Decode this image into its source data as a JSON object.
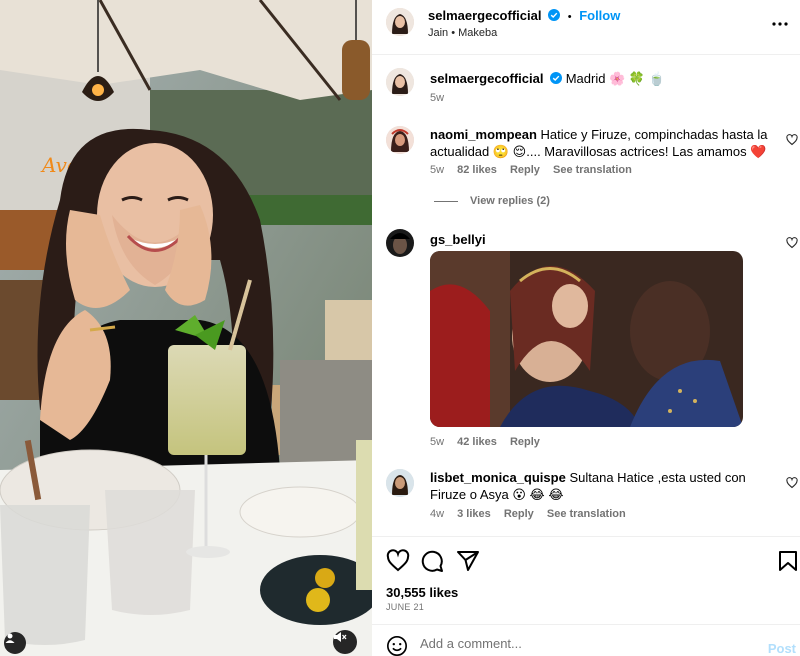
{
  "post": {
    "username": "selmaergecofficial",
    "follow_label": "Follow",
    "separator": "•",
    "audio": "Jain • Makeba",
    "caption": "Madrid 🌸 🍀 🍵",
    "caption_time": "5w"
  },
  "comments": [
    {
      "username": "naomi_mompean",
      "text": "Hatice y Firuze, compinchadas hasta la actualidad 🙄 😌.... Maravillosas actrices! Las amamos ❤️",
      "time": "5w",
      "likes": "82 likes",
      "reply": "Reply",
      "translation": "See translation",
      "view_replies": "View replies (2)"
    },
    {
      "username": "gs_bellyi",
      "text": "",
      "time": "5w",
      "likes": "42 likes",
      "reply": "Reply"
    },
    {
      "username": "lisbet_monica_quispe",
      "text": "Sultana Hatice ,esta usted con Firuze o Asya 😮 😂 😂",
      "time": "4w",
      "likes": "3 likes",
      "reply": "Reply",
      "translation": "See translation"
    }
  ],
  "actions": {
    "likes": "30,555 likes",
    "date": "JUNE 21"
  },
  "composer": {
    "placeholder": "Add a comment...",
    "post_label": "Post"
  },
  "icons": {
    "like": "heart-icon",
    "comment": "comment-icon",
    "share": "share-icon",
    "save": "bookmark-icon",
    "more": "more-icon",
    "emoji": "emoji-icon",
    "mute": "mute-icon",
    "tag": "user-tag-icon",
    "verified": "verified-icon"
  },
  "colors": {
    "accent": "#0095f6",
    "muted_text": "#737373",
    "post_disabled": "#b2dffc",
    "verified": "#0095f6",
    "heart_red": "#e0245e"
  }
}
